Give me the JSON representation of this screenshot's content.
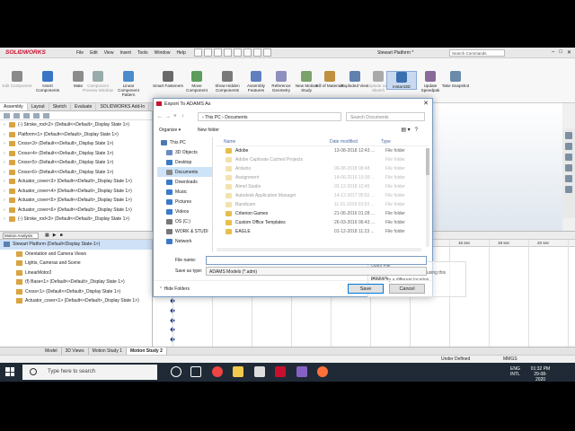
{
  "app": {
    "logo": "SOLIDWORKS",
    "menus": [
      "File",
      "Edit",
      "View",
      "Insert",
      "Tools",
      "Window",
      "Help"
    ],
    "doc_title": "Stewart Platform *",
    "search_placeholder": "Search Commands"
  },
  "ribbon": [
    {
      "label": "Edit Component",
      "dim": true,
      "color": "#8a8a8a"
    },
    {
      "label": "Insert Components",
      "color": "#3a74c4"
    },
    {
      "label": "Mate",
      "color": "#8c8c8c"
    },
    {
      "label": "Component Preview Window",
      "dim": true,
      "color": "#9aa"
    },
    {
      "label": "Linear Component Pattern",
      "color": "#4a8ccc"
    },
    {
      "label": "Smart Fasteners",
      "color": "#6a6a6a"
    },
    {
      "label": "Move Component",
      "color": "#5c9c5c"
    },
    {
      "label": "Show Hidden Components",
      "color": "#7a7a7a"
    },
    {
      "label": "Assembly Features",
      "color": "#5f7fbf"
    },
    {
      "label": "Reference Geometry",
      "color": "#8f8fbf"
    },
    {
      "label": "New Motion Study",
      "color": "#7aa36a"
    },
    {
      "label": "Bill of Materials",
      "color": "#c09040"
    },
    {
      "label": "Exploded View",
      "color": "#6080b0"
    },
    {
      "label": "Explode Line Sketch",
      "dim": true,
      "color": "#aaa"
    },
    {
      "label": "Instant3D",
      "active": true,
      "color": "#3a6fb0"
    },
    {
      "label": "Update Speedpak",
      "color": "#8a6a9a"
    },
    {
      "label": "Take Snapshot",
      "color": "#6a8aaa"
    }
  ],
  "cm_tabs": [
    "Assembly",
    "Layout",
    "Sketch",
    "Evaluate",
    "SOLIDWORKS Add-In"
  ],
  "feature_tree": [
    "(-) Stroke_rod<2> (Default<<Default>_Display State 1>)",
    "Platform<1> (Default<<Default>_Display State 1>)",
    "Cross<3> (Default<<Default>_Display State 1>)",
    "Cross<4> (Default<<Default>_Display State 1>)",
    "Cross<5> (Default<<Default>_Display State 1>)",
    "Cross<6> (Default<<Default>_Display State 1>)",
    "Actuator_cover<3> (Default<<Default>_Display State 1>)",
    "Actuator_cover<4> (Default<<Default>_Display State 1>)",
    "Actuator_cover<5> (Default<<Default>_Display State 1>)",
    "Actuator_cover<6> (Default<<Default>_Display State 1>)",
    "(-) Stroke_rod<3> (Default<<Default>_Display State 1>)"
  ],
  "motion": {
    "study_type": "Motion Analysis",
    "tree": [
      {
        "label": "Stewart Platform  (Default<Display State-1>)",
        "sel": true
      },
      {
        "label": "Orientation and Camera Views"
      },
      {
        "label": "Lights, Cameras and Scene"
      },
      {
        "label": "LinearMotor2"
      },
      {
        "label": "(f) Base<1> (Default<<Default>_Display State 1>)"
      },
      {
        "label": "Cross<1> (Default<<Default>_Display State 1>)"
      },
      {
        "label": "Actuator_cover<1> (Default<<Default>_Display State 1>)"
      }
    ],
    "ticks": [
      "16 sec",
      "18 sec",
      "20 sec"
    ],
    "bottom_tabs": [
      "Model",
      "3D Views",
      "Motion Study 1",
      "Motion Study 2"
    ]
  },
  "status": {
    "left": "Under Defined",
    "units": "MMGS"
  },
  "dialog": {
    "title": "Export To ADAMS As",
    "breadcrumb": "› This PC › Documents",
    "search_placeholder": "Search Documents",
    "organize": "Organize ▾",
    "new_folder": "New folder",
    "nav": [
      {
        "label": "This PC",
        "color": "#4a7ab0"
      },
      {
        "label": "3D Objects",
        "color": "#6a8ac0"
      },
      {
        "label": "Desktop",
        "color": "#3a7ac8"
      },
      {
        "label": "Documents",
        "color": "#8a8a8a",
        "on": true
      },
      {
        "label": "Downloads",
        "color": "#3a7ac8"
      },
      {
        "label": "Music",
        "color": "#3a7ac8"
      },
      {
        "label": "Pictures",
        "color": "#3a7ac8"
      },
      {
        "label": "Videos",
        "color": "#3a7ac8"
      },
      {
        "label": "OS (C:)",
        "color": "#777"
      },
      {
        "label": "WORK & STUDI",
        "color": "#777"
      },
      {
        "label": "Network",
        "color": "#3a7ac8"
      }
    ],
    "columns": {
      "name": "Name",
      "date": "Date modified",
      "type": "Type"
    },
    "files": [
      {
        "name": "Adobe",
        "date": "13-08-2018 12:43 ...",
        "type": "File folder"
      },
      {
        "name": "Adobe Captivate Cached Projects",
        "date": "",
        "type": "File folder",
        "faded": true
      },
      {
        "name": "Arduino",
        "date": "06-08-2018 08:48",
        "type": "File folder",
        "faded": true
      },
      {
        "name": "Assignment",
        "date": "14-06-2016 10:39 ...",
        "type": "File folder",
        "faded": true
      },
      {
        "name": "Atmel Studio",
        "date": "02-12-2018 12:45",
        "type": "File folder",
        "faded": true
      },
      {
        "name": "Autodesk Application Manager",
        "date": "14-12-2017 05:52 ...",
        "type": "File folder",
        "faded": true
      },
      {
        "name": "Bandicam",
        "date": "11-01-2019 03:53 ...",
        "type": "File folder",
        "faded": true
      },
      {
        "name": "Criterion Games",
        "date": "21-06-2016 01:28 ...",
        "type": "File folder"
      },
      {
        "name": "Custom Office Templates",
        "date": "26-03-2016 06:43 ...",
        "type": "File folder"
      },
      {
        "name": "EAGLE",
        "date": "01-12-2018 11:23 ...",
        "type": "File folder"
      }
    ],
    "context": {
      "head": "Open File",
      "line1": "You can't open this location using this program.",
      "line2": "Please try a different location."
    },
    "file_name_label": "File name:",
    "file_name_value": "",
    "save_type_label": "Save as type:",
    "save_type_value": "ADAMS Models (*.adm)",
    "hide_folders": "Hide Folders",
    "save": "Save",
    "cancel": "Cancel"
  },
  "taskbar": {
    "search": "Type here to search",
    "lang1": "ENG",
    "lang2": "INTL",
    "time": "01:32 PM",
    "date": "29-08-2020"
  }
}
